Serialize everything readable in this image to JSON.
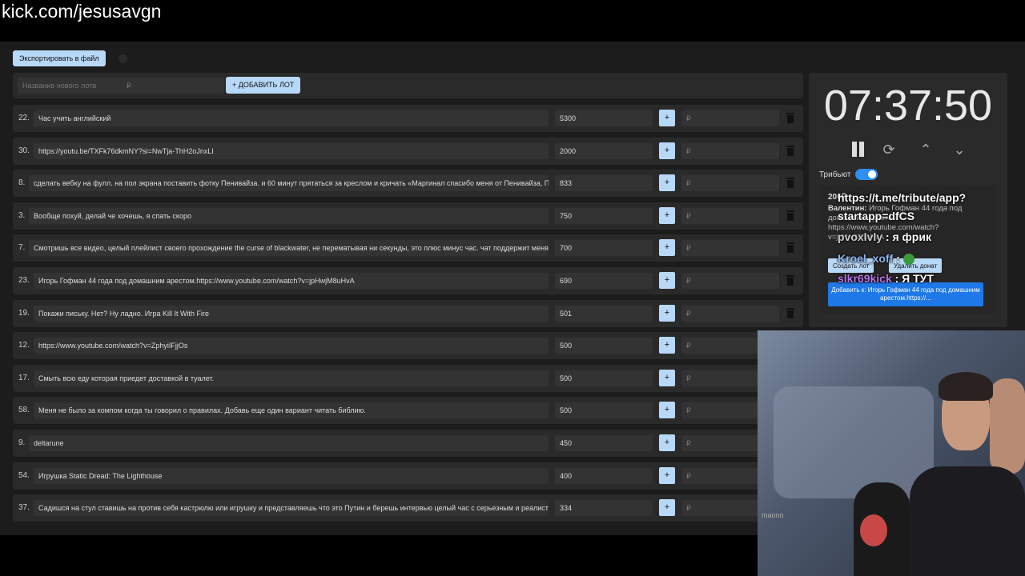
{
  "url": "kick.com/jesusavgn",
  "toolbar": {
    "export_label": "Экспортировать в файл"
  },
  "add_form": {
    "name_placeholder": "Название нового лота",
    "price_placeholder": "₽",
    "add_label": "+ ДОБАВИТЬ ЛОТ"
  },
  "lots": [
    {
      "num": "22.",
      "title": "Час учить английский",
      "amount": "5300"
    },
    {
      "num": "30.",
      "title": "https://youtu.be/TXFk76dkmNY?si=NwTja-ThH2oJnxLI",
      "amount": "2000"
    },
    {
      "num": "8.",
      "title": "сделать вебку на фулл. на пол экрана поставить фотку Пенивайза. и 60 минут прятаться за креслом и кричать «Маргинал спасибо меня от Пенивайза, Пе",
      "amount": "833"
    },
    {
      "num": "3.",
      "title": "Вообще похуй, делай че хочешь, я спать скоро",
      "amount": "750"
    },
    {
      "num": "7.",
      "title": "Смотришь все видео, целый плейлист своего прохождение the curse of blackwater, не перематывая ни секунды, это плюс минус час. чат поддержит меня",
      "amount": "700"
    },
    {
      "num": "23.",
      "title": "Игорь Гофман 44 года под домашним арестом.https://www.youtube.com/watch?v=jpHwjM8uHvA",
      "amount": "690"
    },
    {
      "num": "19.",
      "title": "Покажи письку. Нет? Ну ладно. Игра Kill It With Fire",
      "amount": "501"
    },
    {
      "num": "12.",
      "title": "https://www.youtube.com/watch?v=ZphyiIFjjOs",
      "amount": "500"
    },
    {
      "num": "17.",
      "title": "Смыть всю еду которая приедет доставкой в туалет.",
      "amount": "500"
    },
    {
      "num": "58.",
      "title": "Меня не было за компом когда ты говорил о правилах. Добавь еще один вариант читать библию.",
      "amount": "500"
    },
    {
      "num": "9.",
      "title": "deltarune",
      "amount": "450"
    },
    {
      "num": "54.",
      "title": "Игрушка Static Dread: The Lighthouse",
      "amount": "400"
    },
    {
      "num": "37.",
      "title": "Садишся на стул ставишь на против себя кастрюлю или игрушку и представляешь что это Путин и берешь интервью целый час с серьезным и реалисти",
      "amount": "334"
    }
  ],
  "row_common": {
    "plus_label": "+",
    "currency_placeholder": "₽"
  },
  "timer": {
    "time": "07:37:50"
  },
  "tribute": {
    "label": "Трибьют",
    "donation_amount": "200₽",
    "donor": "Валентин:",
    "message": "Игорь Гофман 44 года под домашним арестом https://www.youtube.com/watch?v=jpHwjM8uHvA",
    "create_lot_label": "Создать лот",
    "delete_label": "Удалить донат",
    "add_to_label": "Добавить к: Игорь Гофман 44 года под домашним арестом.https://..."
  },
  "chat": [
    {
      "user": "",
      "text": "https://t.me/tribute/app?"
    },
    {
      "user": "",
      "text": "startapp=dfCS"
    },
    {
      "user": "pvoxlvly",
      "text": " : я фрик",
      "color": "gray"
    },
    {
      "user": "Kroel_xoff",
      "text": " :",
      "color": "blue"
    },
    {
      "user": "slkr69kick",
      "text": " : Я ТУТ",
      "color": "purple"
    }
  ],
  "webcam": {
    "mic_brand": "maono"
  },
  "colors": {
    "accent": "#b8d8f8",
    "toggle": "#2d8ff0",
    "add_btn": "#1e78e8"
  }
}
